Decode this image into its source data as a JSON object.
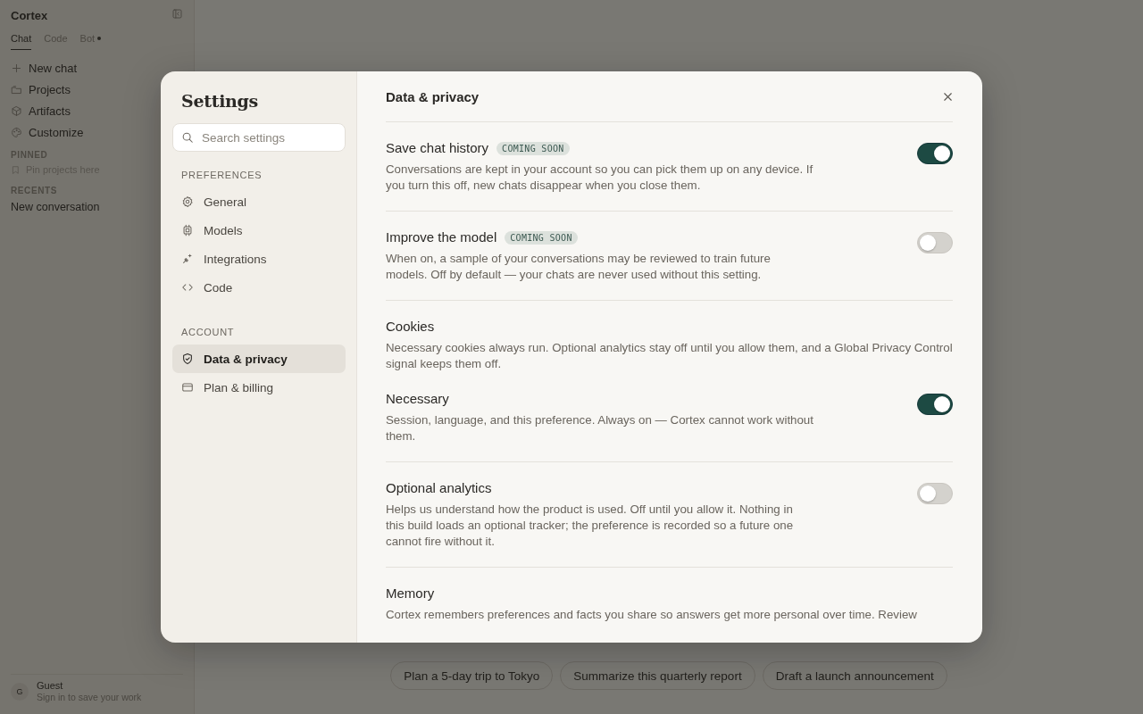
{
  "app": {
    "title": "Cortex",
    "tabs": [
      {
        "label": "Chat",
        "selected": true,
        "dot": false
      },
      {
        "label": "Code",
        "selected": false,
        "dot": false
      },
      {
        "label": "Bot",
        "selected": false,
        "dot": true
      }
    ],
    "nav": [
      {
        "label": "New chat"
      },
      {
        "label": "Projects"
      },
      {
        "label": "Artifacts"
      },
      {
        "label": "Customize"
      }
    ],
    "pinned": {
      "heading": "PINNED",
      "empty_text": "Pin projects here"
    },
    "recents": {
      "heading": "RECENTS",
      "items": [
        "New conversation"
      ]
    },
    "user": {
      "avatar": "G",
      "name": "Guest",
      "subtitle": "Sign in to save your work"
    }
  },
  "suggestions": [
    "Plan a 5-day trip to Tokyo",
    "Summarize this quarterly report",
    "Draft a launch announcement"
  ],
  "settings": {
    "title": "Settings",
    "search": {
      "placeholder": "Search settings"
    },
    "groups": [
      {
        "heading": "PREFERENCES",
        "items": [
          {
            "label": "General",
            "selected": false
          },
          {
            "label": "Models",
            "selected": false
          },
          {
            "label": "Integrations",
            "selected": false
          },
          {
            "label": "Code",
            "selected": false
          }
        ]
      },
      {
        "heading": "ACCOUNT",
        "items": [
          {
            "label": "Data & privacy",
            "selected": true
          },
          {
            "label": "Plan & billing",
            "selected": false
          }
        ]
      }
    ],
    "page_title": "Data & privacy",
    "sections": [
      {
        "kind": "toggle",
        "title": "Save chat history",
        "badge": "COMING SOON",
        "description": "Conversations are kept in your account so you can pick them up on any device. If you turn this off, new chats disappear when you close them.",
        "on": true
      },
      {
        "kind": "toggle",
        "title": "Improve the model",
        "badge": "COMING SOON",
        "description": "When on, a sample of your conversations may be reviewed to train future models. Off by default — your chats are never used without this setting.",
        "on": false
      },
      {
        "kind": "group",
        "title": "Cookies",
        "description": "Necessary cookies always run. Optional analytics stay off until you allow them, and a Global Privacy Control signal keeps them off.",
        "items": [
          {
            "title": "Necessary",
            "description": "Session, language, and this preference. Always on — Cortex cannot work without them.",
            "on": true
          },
          {
            "title": "Optional analytics",
            "description": "Helps us understand how the product is used. Off until you allow it. Nothing in this build loads an optional tracker; the preference is recorded so a future one cannot fire without it.",
            "on": false
          }
        ]
      },
      {
        "kind": "text",
        "title": "Memory",
        "description": "Cortex remembers preferences and facts you share so answers get more personal over time. Review"
      }
    ]
  }
}
